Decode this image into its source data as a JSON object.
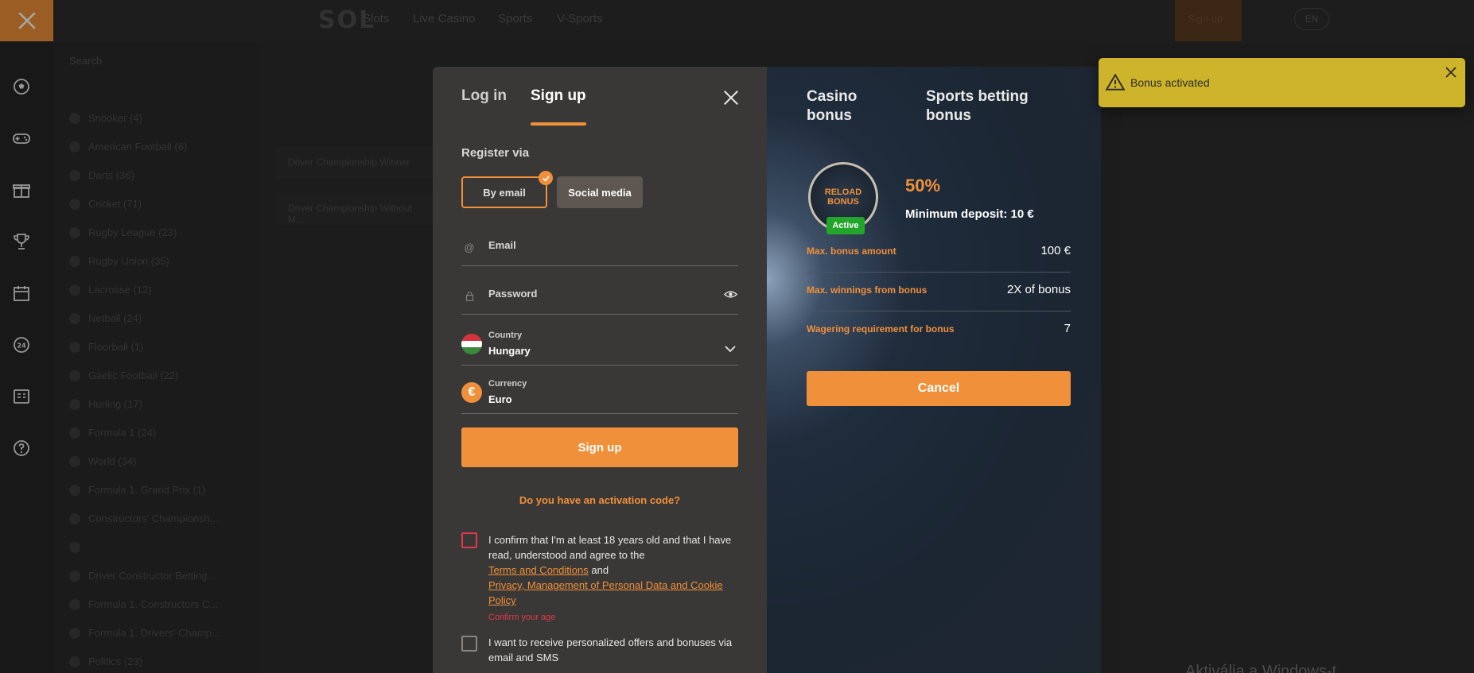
{
  "background": {
    "logo": "SOL",
    "topnav": [
      "Slots",
      "Live Casino",
      "Sports",
      "V-Sports"
    ],
    "signin_label": "Sign up",
    "lang": "EN",
    "search_placeholder": "Search",
    "sports_list": [
      "Snooker (4)",
      "American Football (6)",
      "Darts (36)",
      "Cricket (71)",
      "Rugby League (23)",
      "Rugby Union (35)",
      "Lacrosse (12)",
      "Netball (24)",
      "Floorball (1)",
      "Gaelic Football (22)",
      "Hurling (17)",
      "Formula 1 (24)",
      "World (34)",
      "Formula 1. Grand Prix (1)",
      "Constructors' Championsh...",
      "",
      "Driver Constructor Betting...",
      "Formula 1. Constructors C...",
      "Formula 1. Drivers' Champ...",
      "Politics (23)"
    ],
    "cards": [
      "Driver Championship Winner",
      "Driver Championship Without M..."
    ],
    "watermark": "Aktiválja a Windows-t"
  },
  "modal": {
    "tabs": {
      "login": "Log in",
      "signup": "Sign up"
    },
    "register_via": "Register via",
    "by_email": "By email",
    "social_media": "Social media",
    "email_placeholder": "Email",
    "password_placeholder": "Password",
    "country": {
      "label": "Country",
      "value": "Hungary"
    },
    "currency": {
      "label": "Currency",
      "value": "Euro",
      "symbol": "€"
    },
    "signup_button": "Sign up",
    "activation_code": "Do you have an activation code?",
    "consent": {
      "text": "I confirm that I'm at least 18 years old and that I have read, understood and agree to the",
      "terms_link": "Terms and Conditions",
      "and": "and",
      "privacy_link": "Privacy, Management of Personal Data and Cookie Policy",
      "error": "Confirm your age"
    },
    "offers_text": "I want to receive personalized offers and bonuses via email and SMS"
  },
  "bonus": {
    "tab_casino": "Casino bonus",
    "tab_sports": "Sports betting bonus",
    "badge_text": "RELOAD BONUS",
    "badge_status": "Active",
    "percent": "50%",
    "min_deposit": "Minimum deposit: 10 €",
    "rows": [
      {
        "key": "Max. bonus amount",
        "value": "100 €"
      },
      {
        "key": "Max. winnings from bonus",
        "value": "2X of bonus"
      },
      {
        "key": "Wagering requirement for bonus",
        "value": "7"
      }
    ],
    "cancel": "Cancel"
  },
  "toast": {
    "message": "Bonus activated"
  },
  "colors": {
    "accent": "#f0903a",
    "toast": "#cdb42a",
    "active": "#22a52a",
    "error": "#e0394a"
  }
}
